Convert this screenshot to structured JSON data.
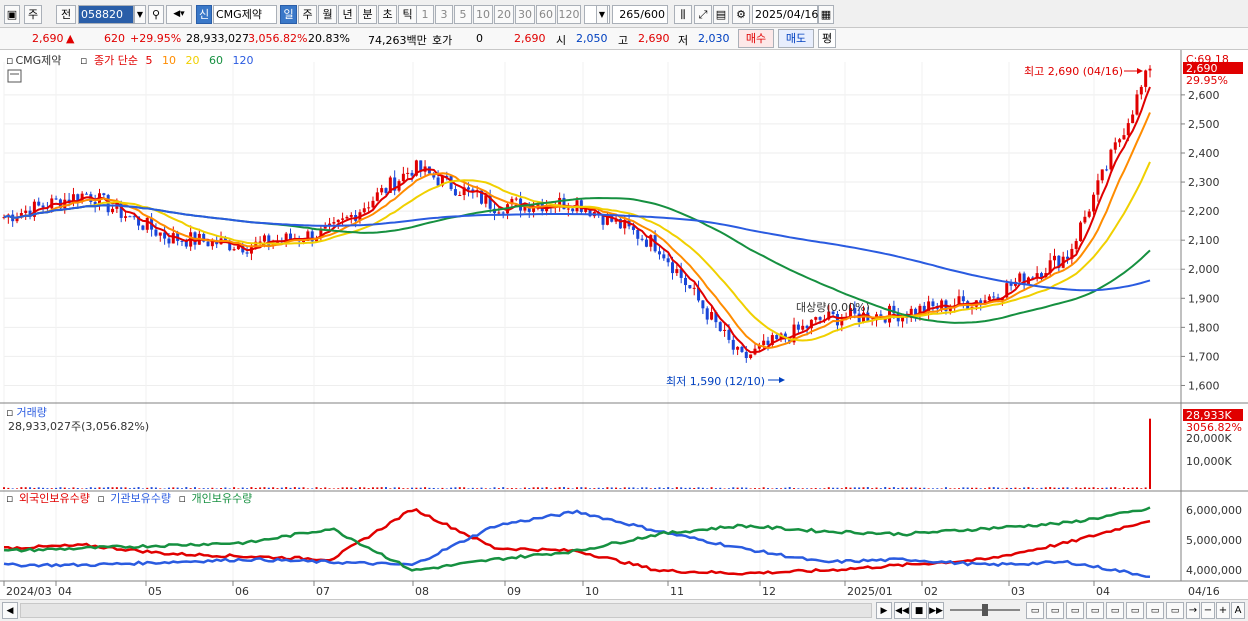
{
  "toolbar": {
    "market": "주",
    "prev": "전",
    "code": "058820",
    "name": "CMG제약",
    "new_badge": "신",
    "periods": [
      "일",
      "주",
      "월",
      "년",
      "분",
      "초",
      "틱"
    ],
    "active_period": "일",
    "numbers": [
      "1",
      "3",
      "5",
      "10",
      "20",
      "30",
      "60",
      "120"
    ],
    "count": "265",
    "count_total": "/600",
    "date": "2025/04/16"
  },
  "infobar": {
    "price": "2,690",
    "change": "620",
    "change_pct": "+29.95%",
    "volume": "28,933,027",
    "vol_pct": "3,056.82%",
    "turnover": "20.83%",
    "amount": "74,263백만",
    "quote_label": "호가",
    "quote_val": "0",
    "quote_price": "2,690",
    "open_label": "시",
    "open": "2,050",
    "high_label": "고",
    "high": "2,690",
    "low_label": "저",
    "low": "2,030",
    "buy": "매수",
    "sell": "매도",
    "eval": "평"
  },
  "price_panel": {
    "title": "CMG제약",
    "ma_label": "종가 단순",
    "ma_periods": [
      {
        "p": "5",
        "color": "#e00000"
      },
      {
        "p": "10",
        "color": "#ff8c00"
      },
      {
        "p": "20",
        "color": "#f0d000"
      },
      {
        "p": "60",
        "color": "#169040"
      },
      {
        "p": "120",
        "color": "#2a5be0"
      }
    ],
    "y_ticks": [
      "2,600",
      "2,500",
      "2,400",
      "2,300",
      "2,200",
      "2,100",
      "2,000",
      "1,900",
      "1,800",
      "1,700",
      "1,600"
    ],
    "top_label": "C:69.18",
    "last_price": "2,690",
    "last_pct": "29.95%",
    "high_note": "최고 2,690 (04/16)",
    "low_note": "최저 1,590 (12/10)",
    "mid_note": "대상량(0.00%)"
  },
  "volume_panel": {
    "title": "거래량",
    "value": "28,933,027주(3,056.82%)",
    "y_ticks": [
      "20,000K",
      "10,000K"
    ],
    "last_label": "28,933K",
    "last_pct": "3056.82%"
  },
  "holding_panel": {
    "labels": [
      {
        "name": "외국인보유수량",
        "color": "#e00000"
      },
      {
        "name": "기관보유수량",
        "color": "#2a5be0"
      },
      {
        "name": "개인보유수량",
        "color": "#169040"
      }
    ],
    "y_ticks": [
      "6,000,000",
      "5,000,000",
      "4,000,000"
    ]
  },
  "x_axis": {
    "labels": [
      "2024/03",
      "04",
      "05",
      "06",
      "07",
      "08",
      "09",
      "10",
      "11",
      "12",
      "2025/01",
      "02",
      "03",
      "04"
    ],
    "last": "04/16"
  },
  "chart_data": {
    "type": "line",
    "x": [
      "2024/03",
      "04",
      "05",
      "06",
      "07",
      "08",
      "09",
      "10",
      "11",
      "12",
      "2025/01",
      "02",
      "03",
      "04",
      "04/16"
    ],
    "series": [
      {
        "name": "종가",
        "values": [
          2180,
          2260,
          2110,
          2080,
          2130,
          2350,
          2220,
          2230,
          2080,
          1690,
          1830,
          1850,
          1900,
          2050,
          2690
        ]
      },
      {
        "name": "120",
        "values": [
          2240,
          2230,
          2220,
          2200,
          2190,
          2200,
          2210,
          2200,
          2190,
          2150,
          2080,
          2000,
          1960,
          1930,
          1910
        ]
      },
      {
        "name": "60",
        "values": [
          2270,
          2220,
          2160,
          2130,
          2120,
          2180,
          2230,
          2240,
          2120,
          1980,
          1900,
          1860,
          1840,
          1850,
          1890
        ]
      }
    ],
    "ylim": [
      1550,
      2720
    ]
  }
}
